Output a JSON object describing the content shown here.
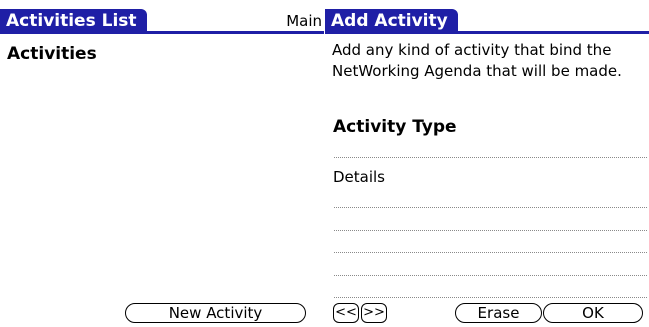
{
  "left_screen": {
    "title": "Activities List",
    "menu": "Main",
    "heading": "Activities",
    "new_activity_button": "New Activity"
  },
  "right_screen": {
    "title": "Add Activity",
    "description": "Add any kind of activity that bind the NetWorking Agenda that will be made.",
    "activity_type_label": "Activity Type",
    "details_label": "Details",
    "prev_button": "<<",
    "next_button": ">>",
    "erase_button": "Erase",
    "ok_button": "OK"
  },
  "colors": {
    "title_bar": "#1f1fa6"
  }
}
